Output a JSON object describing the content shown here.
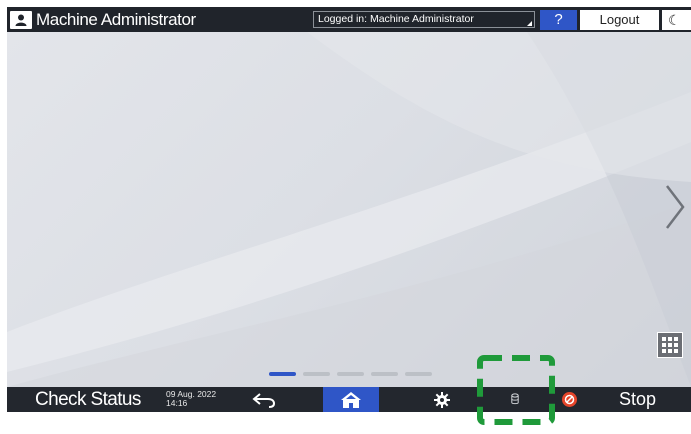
{
  "top_bar": {
    "user_name": "Machine Administrator",
    "logged_in_text": "Logged in: Machine Administrator",
    "help_label": "?",
    "logout_label": "Logout",
    "sleep_label": "☾"
  },
  "pager": {
    "page_count": 5,
    "current_page": 1
  },
  "bottom_bar": {
    "check_status_label": "Check Status",
    "date": "09 Aug. 2022",
    "time": "14:16",
    "stop_label": "Stop"
  },
  "icons": {
    "user": "user-icon",
    "next": "chevron-right-icon",
    "apps": "grid-icon",
    "back": "back-arrow-icon",
    "home": "home-icon",
    "settings": "gear-icon",
    "storage": "storage-icon",
    "stop": "stop-icon"
  },
  "colors": {
    "bar_background": "#23272e",
    "accent_blue": "#2f56c7",
    "highlight_green": "#1f9a3a",
    "stop_red": "#e5452b"
  }
}
